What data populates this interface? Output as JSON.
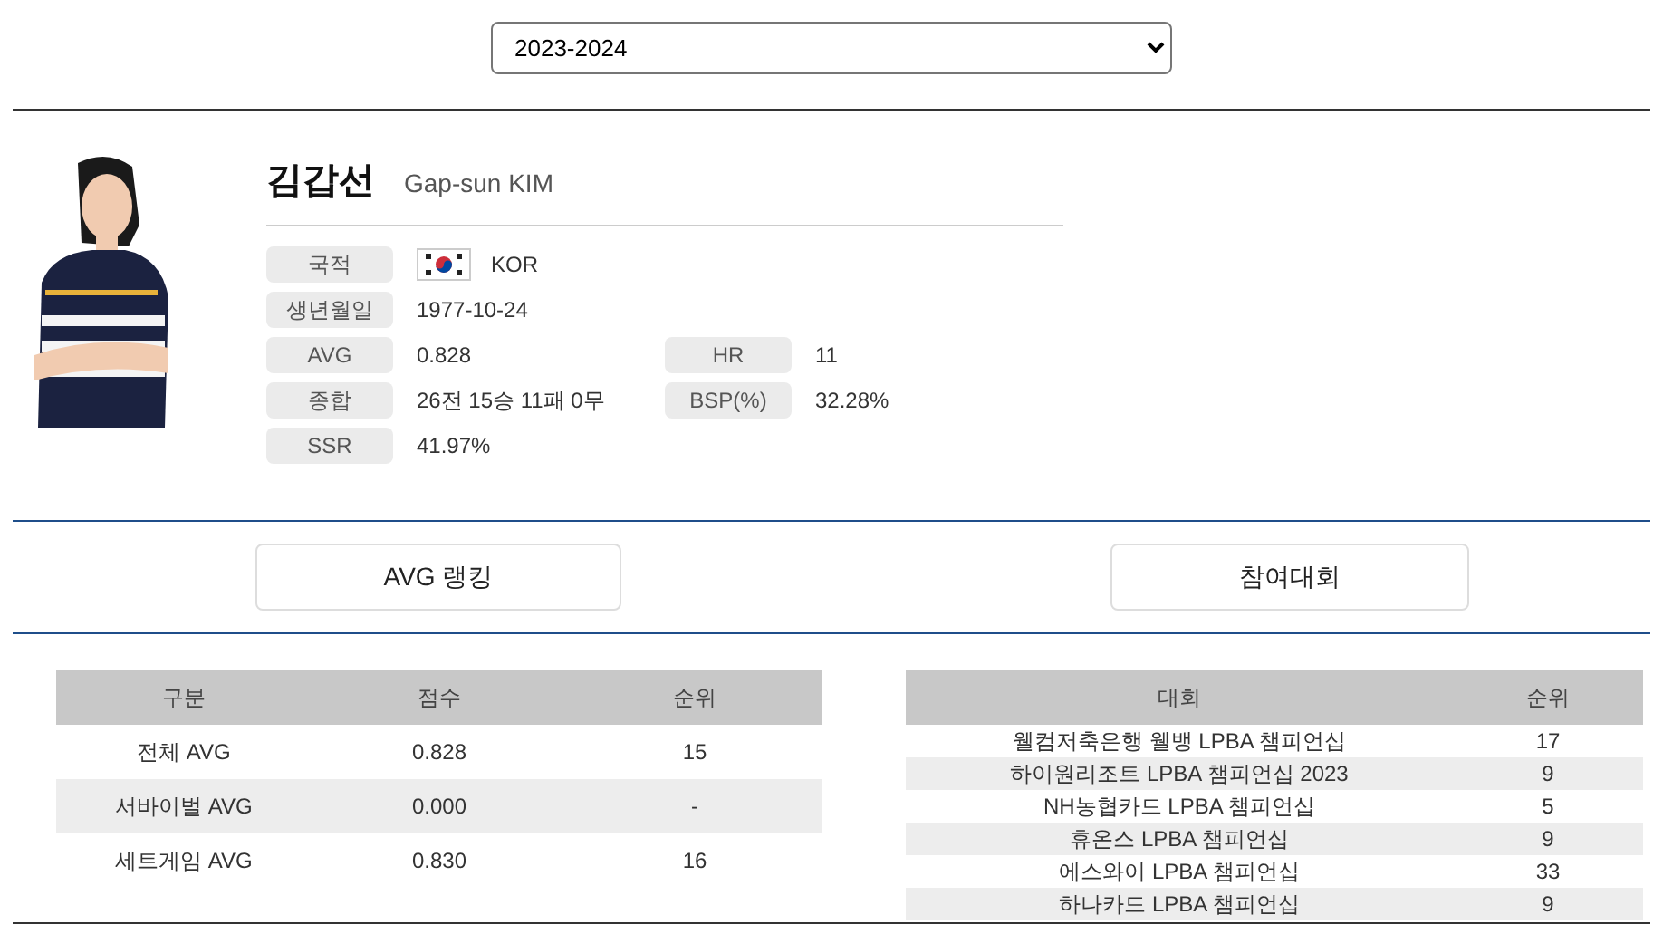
{
  "season_select": {
    "value": "2023-2024"
  },
  "player": {
    "name_ko": "김갑선",
    "name_en": "Gap-sun KIM",
    "fields": [
      {
        "label": "국적",
        "value": "KOR",
        "kind": "flag"
      },
      {
        "label": "생년월일",
        "value": "1977-10-24"
      },
      {
        "label": "AVG",
        "value": "0.828"
      },
      {
        "label": "HR",
        "value": "11"
      },
      {
        "label": "종합",
        "value": "26전 15승 11패 0무"
      },
      {
        "label": "BSP(%)",
        "value": "32.28%"
      },
      {
        "label": "SSR",
        "value": "41.97%"
      }
    ]
  },
  "buttons": [
    "AVG 랭킹",
    "참여대회"
  ],
  "ranking_table": {
    "columns": [
      "구분",
      "점수",
      "순위"
    ],
    "rows": [
      [
        "전체 AVG",
        "0.828",
        "15"
      ],
      [
        "서바이벌 AVG",
        "0.000",
        "-"
      ],
      [
        "세트게임 AVG",
        "0.830",
        "16"
      ]
    ]
  },
  "tournament_table": {
    "columns": [
      "대회",
      "순위"
    ],
    "rows": [
      [
        "웰컴저축은행 웰뱅 LPBA 챔피언십",
        "17"
      ],
      [
        "하이원리조트 LPBA 챔피언십 2023",
        "9"
      ],
      [
        "NH농협카드 LPBA 챔피언십",
        "5"
      ],
      [
        "휴온스 LPBA 챔피언십",
        "9"
      ],
      [
        "에스와이 LPBA 챔피언십",
        "33"
      ],
      [
        "하나카드 LPBA 챔피언십",
        "9"
      ]
    ]
  }
}
